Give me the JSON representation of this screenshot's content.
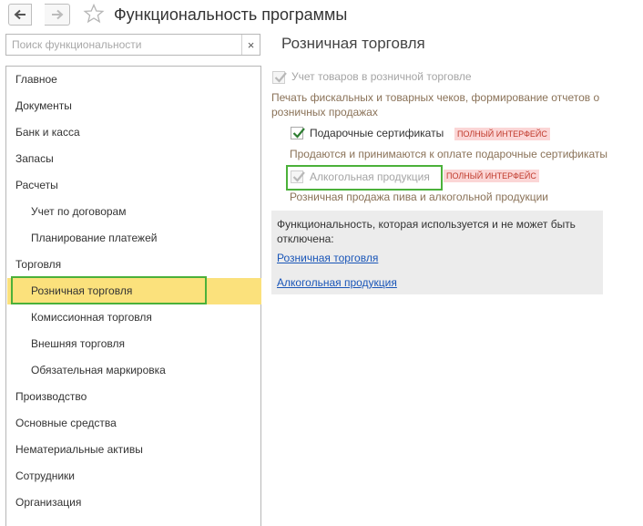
{
  "header": {
    "title": "Функциональность программы",
    "back_icon": "arrow-left-icon",
    "forward_icon": "arrow-right-icon",
    "favorite_icon": "star-icon"
  },
  "search": {
    "placeholder": "Поиск функциональности",
    "clear_label": "×"
  },
  "sidebar": {
    "items": [
      {
        "label": "Главное"
      },
      {
        "label": "Документы"
      },
      {
        "label": "Банк и касса"
      },
      {
        "label": "Запасы"
      },
      {
        "label": "Расчеты"
      },
      {
        "label": "Учет по договорам"
      },
      {
        "label": "Планирование платежей"
      },
      {
        "label": "Торговля"
      },
      {
        "label": "Розничная торговля"
      },
      {
        "label": "Комиссионная торговля"
      },
      {
        "label": "Внешняя торговля"
      },
      {
        "label": "Обязательная маркировка"
      },
      {
        "label": "Производство"
      },
      {
        "label": "Основные средства"
      },
      {
        "label": "Нематериальные активы"
      },
      {
        "label": "Сотрудники"
      },
      {
        "label": "Организация"
      }
    ],
    "selected": "Розничная торговля"
  },
  "main": {
    "section_title": "Розничная торговля",
    "options": [
      {
        "label": "Учет товаров в розничной торговле",
        "checked": true,
        "disabled": true,
        "description": "Печать фискальных и товарных чеков, формирование отчетов о розничных продажах"
      },
      {
        "label": "Подарочные сертификаты",
        "checked": true,
        "disabled": false,
        "badge": "ПОЛНЫЙ ИНТЕРФЕЙС",
        "description": "Продаются и принимаются к оплате подарочные сертификаты"
      },
      {
        "label": "Алкогольная продукция",
        "checked": true,
        "disabled": true,
        "badge": "ПОЛНЫЙ ИНТЕРФЕЙС",
        "description": "Розничная продажа пива и алкогольной продукции"
      }
    ],
    "info": {
      "text": "Функциональность, которая используется и не может быть отключена:",
      "links": [
        "Розничная торговля",
        "Алкогольная продукция"
      ]
    }
  },
  "colors": {
    "selected_bg": "#fbe17c",
    "highlight_border": "#4bb13a",
    "badge_bg": "#fbd6d6",
    "badge_text": "#c0392b",
    "link": "#1a56b8",
    "checkmark": "#2e7d32"
  }
}
